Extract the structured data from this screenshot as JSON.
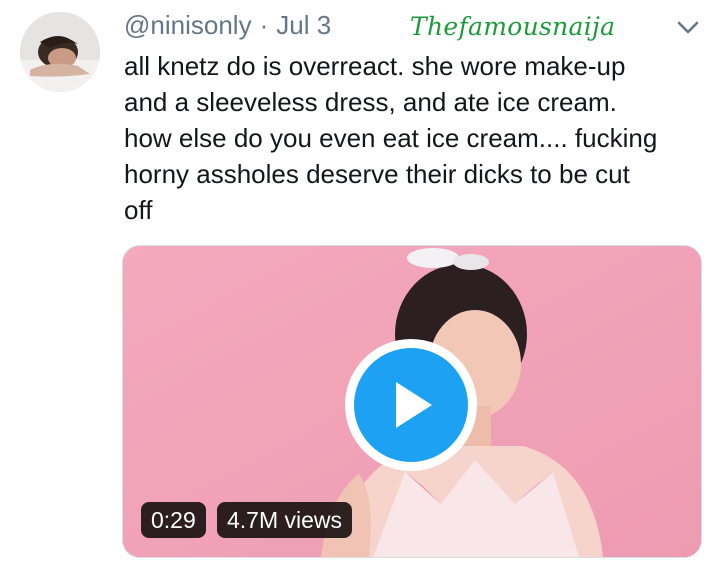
{
  "tweet": {
    "handle": "@ninisonly",
    "separator": "·",
    "date": "Jul 3",
    "text": "all knetz do is overreact. she wore make-up\nand a sleeveless dress, and ate ice cream.\nhow else do you even eat ice cream.... fucking\nhorny assholes deserve their dicks to be cut\noff"
  },
  "watermark": "Thefamousnaija",
  "video": {
    "duration": "0:29",
    "views": "4.7M views"
  },
  "icons": {
    "menu": "chevron-down-icon",
    "play": "play-icon"
  },
  "colors": {
    "accent": "#1da1f2",
    "muted": "#657786",
    "watermark": "#1b9b3a",
    "thumbnail_bg": "#f0a0b6"
  }
}
